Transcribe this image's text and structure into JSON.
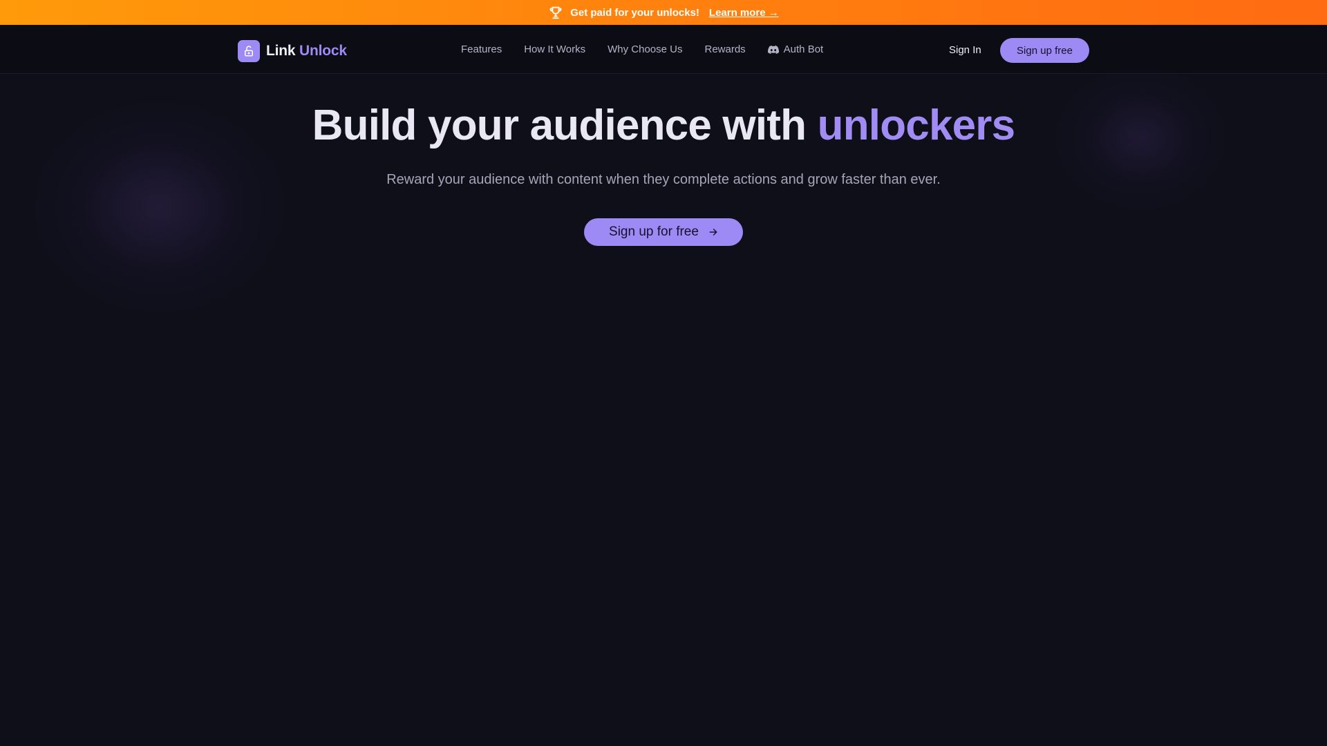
{
  "promo": {
    "message": "Get paid for your unlocks!",
    "link_label": "Learn more →",
    "icon": "trophy-icon"
  },
  "brand": {
    "name_primary": "Link",
    "name_accent": "Unlock",
    "icon": "lock-icon"
  },
  "nav": {
    "items": [
      {
        "label": "Features"
      },
      {
        "label": "How It Works"
      },
      {
        "label": "Why Choose Us"
      },
      {
        "label": "Rewards"
      },
      {
        "label": "Auth Bot",
        "icon": "discord-icon"
      }
    ],
    "sign_in": "Sign In",
    "sign_up": "Sign up free"
  },
  "hero": {
    "title_main": "Build your audience with ",
    "title_accent": "unlockers",
    "subtitle": "Reward your audience with content when they complete actions and grow faster than ever.",
    "cta_label": "Sign up for free",
    "cta_icon": "arrow-right-icon"
  },
  "colors": {
    "accent": "#9d8af5",
    "background": "#0f0f1a",
    "promo_start": "#ff9a0a",
    "promo_end": "#ff6b12"
  }
}
